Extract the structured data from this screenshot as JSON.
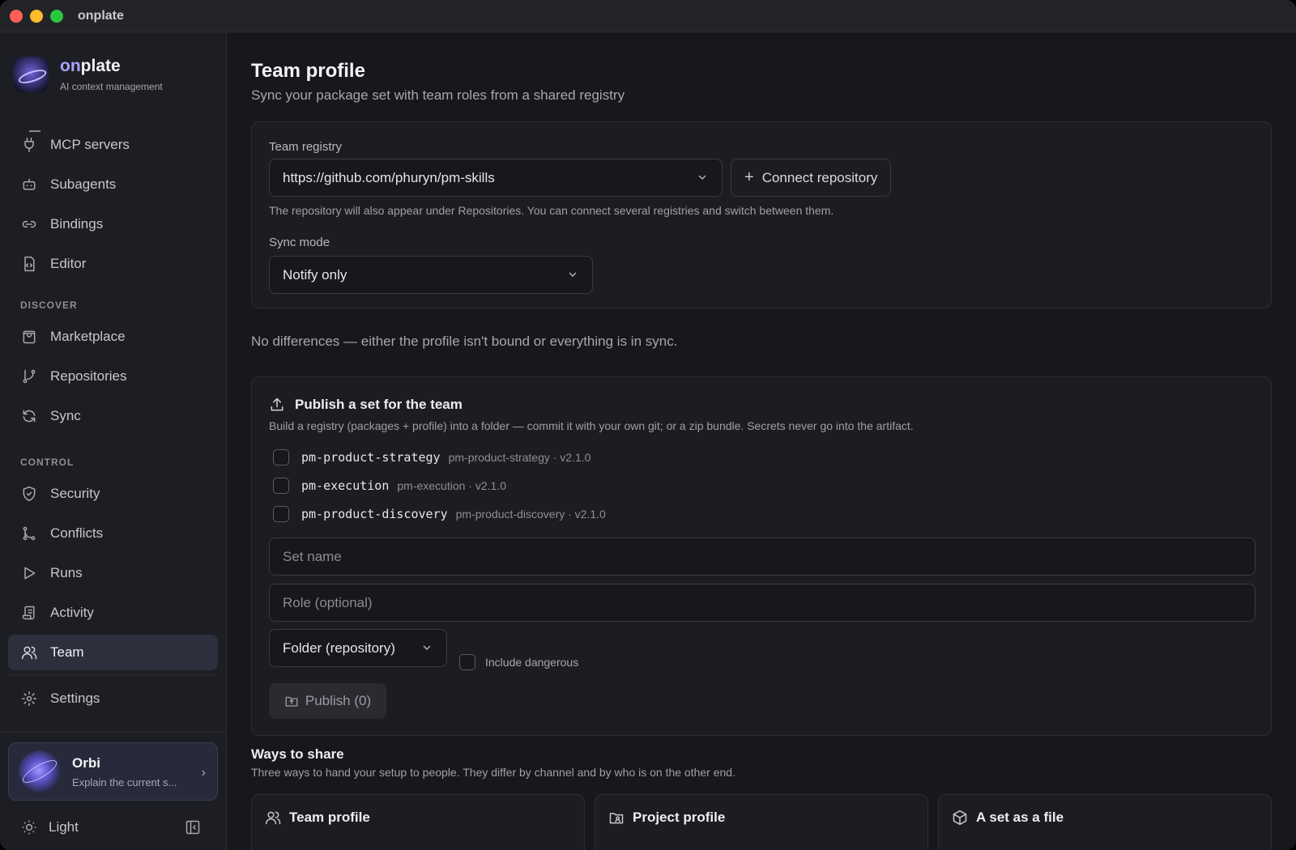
{
  "window": {
    "title": "onplate"
  },
  "brand": {
    "name_prefix": "on",
    "name_rest": "plate",
    "subtitle": "AI context management"
  },
  "sidebar": {
    "items_top": [
      {
        "label": "MCP servers",
        "icon": "plug-icon"
      },
      {
        "label": "Subagents",
        "icon": "robot-icon"
      },
      {
        "label": "Bindings",
        "icon": "link-icon"
      },
      {
        "label": "Editor",
        "icon": "code-file-icon"
      }
    ],
    "discover_label": "DISCOVER",
    "items_discover": [
      {
        "label": "Marketplace",
        "icon": "shopping-bag-icon"
      },
      {
        "label": "Repositories",
        "icon": "git-branch-icon"
      },
      {
        "label": "Sync",
        "icon": "refresh-icon"
      }
    ],
    "control_label": "CONTROL",
    "items_control": [
      {
        "label": "Security",
        "icon": "shield-icon"
      },
      {
        "label": "Conflicts",
        "icon": "git-merge-icon"
      },
      {
        "label": "Runs",
        "icon": "play-icon"
      },
      {
        "label": "Activity",
        "icon": "scroll-icon"
      },
      {
        "label": "Team",
        "icon": "users-icon"
      }
    ],
    "settings_label": "Settings",
    "orbi": {
      "name": "Orbi",
      "subtitle": "Explain the current s..."
    },
    "theme_label": "Light"
  },
  "main": {
    "title": "Team profile",
    "subtitle": "Sync your package set with team roles from a shared registry",
    "registry": {
      "label": "Team registry",
      "value": "https://github.com/phuryn/pm-skills",
      "connect_label": "Connect repository",
      "hint": "The repository will also appear under Repositories. You can connect several registries and switch between them.",
      "sync_label": "Sync mode",
      "sync_value": "Notify only"
    },
    "status": "No differences — either the profile isn't bound or everything is in sync.",
    "publish": {
      "title": "Publish a set for the team",
      "description": "Build a registry (packages + profile) into a folder — commit it with your own git; or a zip bundle. Secrets never go into the artifact.",
      "packages": [
        {
          "name": "pm-product-strategy",
          "meta": "pm-product-strategy · v2.1.0"
        },
        {
          "name": "pm-execution",
          "meta": "pm-execution · v2.1.0"
        },
        {
          "name": "pm-product-discovery",
          "meta": "pm-product-discovery · v2.1.0"
        }
      ],
      "set_name_placeholder": "Set name",
      "role_placeholder": "Role (optional)",
      "target_value": "Folder (repository)",
      "include_dangerous_label": "Include dangerous",
      "publish_label": "Publish (0)"
    },
    "share": {
      "title": "Ways to share",
      "subtitle": "Three ways to hand your setup to people. They differ by channel and by who is on the other end.",
      "cards": [
        {
          "label": "Team profile",
          "icon": "users-icon"
        },
        {
          "label": "Project profile",
          "icon": "folder-user-icon"
        },
        {
          "label": "A set as a file",
          "icon": "package-icon"
        }
      ]
    }
  }
}
